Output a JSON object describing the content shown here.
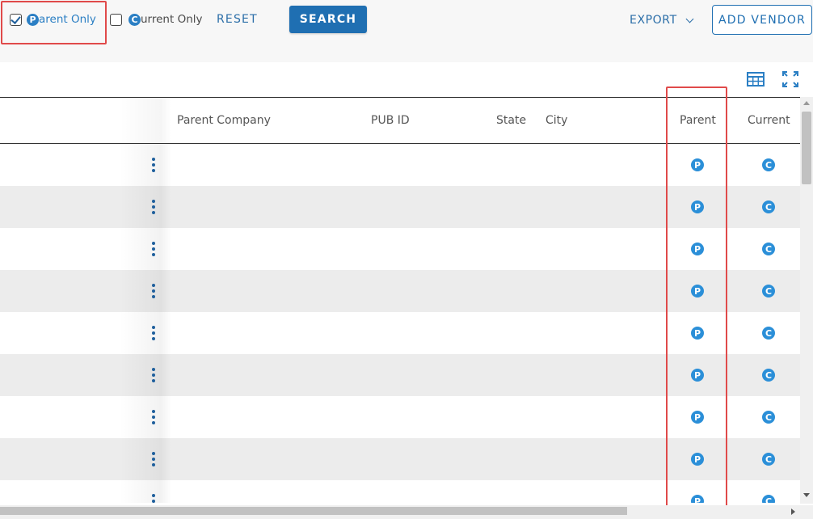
{
  "filters": {
    "parent_only": {
      "badge": "P",
      "label": "arent Only",
      "checked": true
    },
    "current_only": {
      "badge": "C",
      "label": "urrent Only",
      "checked": false
    }
  },
  "toolbar": {
    "reset_label": "RESET",
    "search_label": "SEARCH",
    "export_label": "EXPORT",
    "add_vendor_label": "ADD VENDOR"
  },
  "table": {
    "columns": [
      "Parent Company",
      "PUB ID",
      "State",
      "City",
      "Parent",
      "Current"
    ],
    "row_count": 9,
    "parent_icon": "P",
    "current_icon": "C"
  },
  "colors": {
    "accent": "#1f6fb2",
    "icon_blue": "#2b8fd8",
    "highlight": "#e04a4a"
  },
  "icons": [
    "grid-columns-icon",
    "expand-fullscreen-icon",
    "kebab-menu-icon",
    "chevron-down-icon"
  ]
}
